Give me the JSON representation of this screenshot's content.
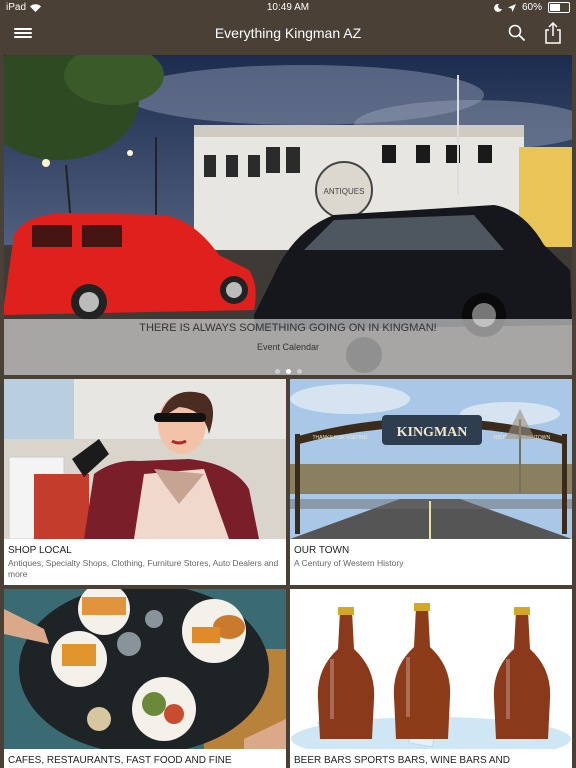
{
  "status": {
    "carrier": "iPad",
    "time": "10:49 AM",
    "battery": "60%",
    "battery_level": 0.6
  },
  "nav": {
    "title": "Everything Kingman AZ"
  },
  "hero": {
    "title": "THERE IS ALWAYS SOMETHING GOING ON IN KINGMAN!",
    "subtitle": "Event Calendar",
    "page_dots": 3,
    "active_dot": 1,
    "sign_text": "ANTIQUES"
  },
  "tiles": [
    {
      "title": "SHOP LOCAL",
      "subtitle": "Antiques, Specialty Shops, Clothing, Furniture Stores, Auto Dealers and more"
    },
    {
      "title": "OUR TOWN",
      "subtitle": "A Century of Western History",
      "arch_text": "KINGMAN",
      "arch_left": "THANKS FOR VISITING",
      "arch_right": "HISTORIC DOWNTOWN"
    },
    {
      "title": "CAFES, RESTAURANTS, FAST FOOD AND FINE",
      "subtitle": ""
    },
    {
      "title": "BEER BARS SPORTS BARS, WINE BARS AND",
      "subtitle": ""
    }
  ],
  "colors": {
    "bar_bg": "#4a4036",
    "tile_bg": "#ffffff",
    "caption": "#222222"
  }
}
